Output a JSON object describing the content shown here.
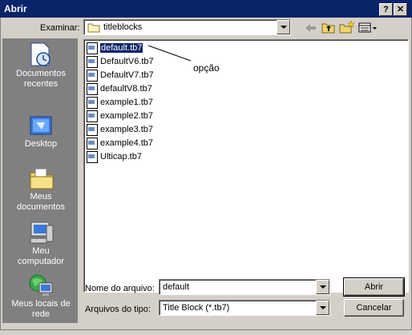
{
  "window": {
    "title": "Abrir",
    "help_label": "?",
    "close_label": "✕"
  },
  "lookin": {
    "label": "Examinar:",
    "value": "titleblocks"
  },
  "places": [
    {
      "label": "Documentos recentes",
      "icon": "recent-documents-icon"
    },
    {
      "label": "Desktop",
      "icon": "desktop-icon"
    },
    {
      "label": "Meus documentos",
      "icon": "my-documents-icon"
    },
    {
      "label": "Meu computador",
      "icon": "my-computer-icon"
    },
    {
      "label": "Meus locais de rede",
      "icon": "network-places-icon"
    }
  ],
  "files": [
    "default.tb7",
    "DefaultV6.tb7",
    "DefaultV7.tb7",
    "defaultV8.tb7",
    "example1.tb7",
    "example2.tb7",
    "example3.tb7",
    "example4.tb7",
    "Ulticap.tb7"
  ],
  "selected_file_index": 0,
  "annotation": "opção",
  "filename": {
    "label": "Nome do arquivo:",
    "value": "default"
  },
  "filetype": {
    "label": "Arquivos do tipo:",
    "value": "Title Block (*.tb7)"
  },
  "buttons": {
    "open": "Abrir",
    "cancel": "Cancelar"
  },
  "colors": {
    "titlebar": "#0a246a",
    "selection": "#0a246a",
    "dialog": "#d4d0c8",
    "places": "#808080"
  }
}
